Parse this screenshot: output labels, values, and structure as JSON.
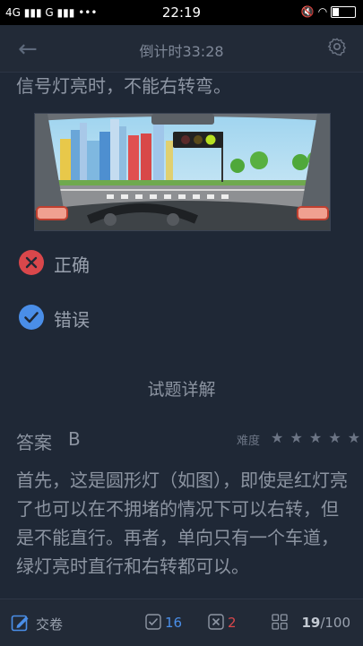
{
  "status_bar": {
    "network": "4G",
    "carrier": "G",
    "dots": "•••",
    "time": "22:19"
  },
  "header": {
    "title": "倒计时33:28"
  },
  "question": {
    "text": "信号灯亮时，不能右转弯。"
  },
  "options": [
    {
      "label": "正确",
      "state": "wrong",
      "color": "#d9474b"
    },
    {
      "label": "错误",
      "state": "correct",
      "color": "#4a8ee8"
    }
  ],
  "detail": {
    "section_title": "试题详解",
    "answer_label": "答案",
    "answer_value": "B",
    "difficulty_label": "难度",
    "difficulty_stars": 5,
    "explanation": "首先，这是圆形灯（如图），即使是红灯亮了也可以在不拥堵的情况下可以右转，但是不能直行。再者，单向只有一个车道，绿灯亮时直行和右转都可以。"
  },
  "bottom_bar": {
    "submit_label": "交卷",
    "correct_count": "16",
    "wrong_count": "2",
    "progress_current": "19",
    "progress_total": "/100"
  },
  "colors": {
    "background": "#1f2836",
    "header": "#222a37",
    "correct": "#4a8ee8",
    "wrong": "#d9474b"
  }
}
